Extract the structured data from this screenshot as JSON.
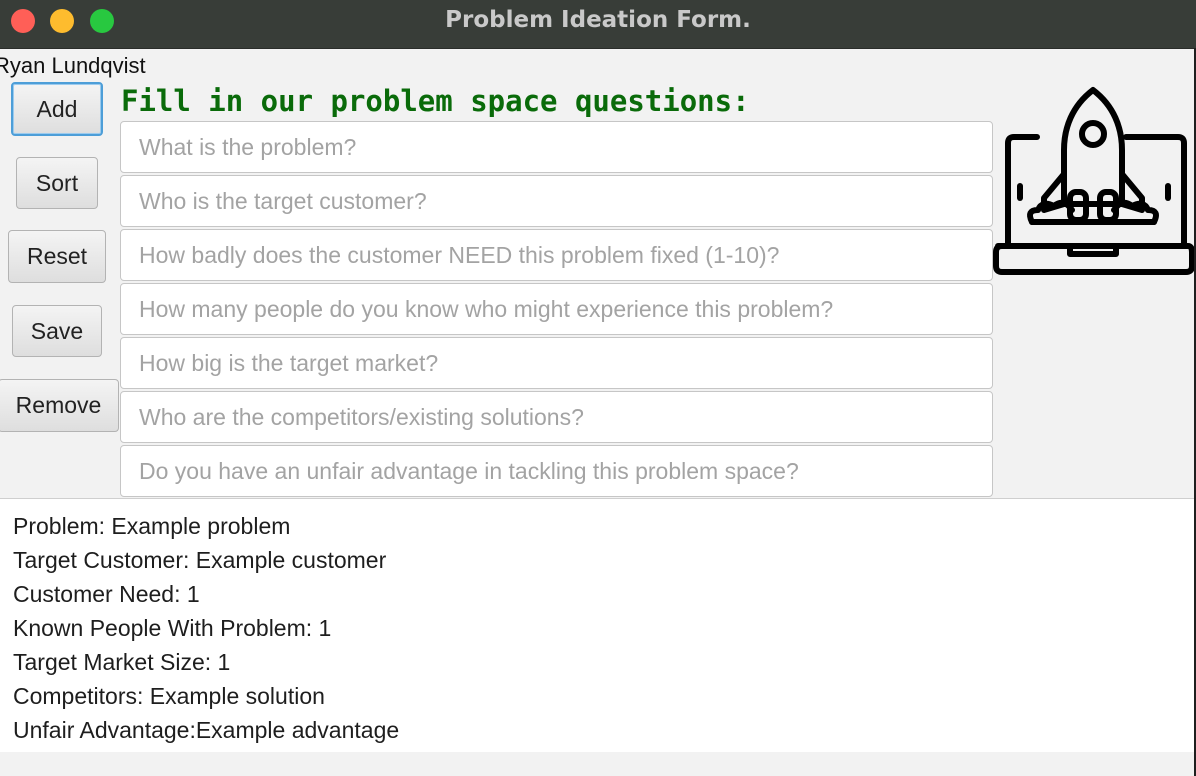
{
  "window": {
    "title": "Problem Ideation Form."
  },
  "user": {
    "name": "Ryan Lundqvist"
  },
  "buttons": {
    "add": "Add",
    "sort": "Sort",
    "reset": "Reset",
    "save": "Save",
    "remove": "Remove"
  },
  "form": {
    "heading": "Fill in our problem space questions:",
    "fields": [
      {
        "placeholder": "What is the problem?",
        "value": ""
      },
      {
        "placeholder": "Who is the target customer?",
        "value": ""
      },
      {
        "placeholder": "How badly does the customer NEED this problem fixed (1-10)?",
        "value": ""
      },
      {
        "placeholder": "How many people do you know who might experience this problem?",
        "value": ""
      },
      {
        "placeholder": "How big is the target market?",
        "value": ""
      },
      {
        "placeholder": "Who are the competitors/existing solutions?",
        "value": ""
      },
      {
        "placeholder": "Do you have an unfair advantage in tackling this problem space?",
        "value": ""
      }
    ]
  },
  "output": {
    "lines": [
      "Problem: Example problem",
      "Target Customer: Example customer",
      "Customer Need: 1",
      "Known People With Problem: 1",
      "Target Market Size: 1",
      "Competitors: Example solution",
      "Unfair Advantage:Example advantage"
    ]
  },
  "icons": {
    "logo": "rocket-laptop-icon"
  },
  "colors": {
    "heading": "#0a6b0a",
    "titlebar": "#383d38",
    "focus": "#4d9ed8"
  }
}
